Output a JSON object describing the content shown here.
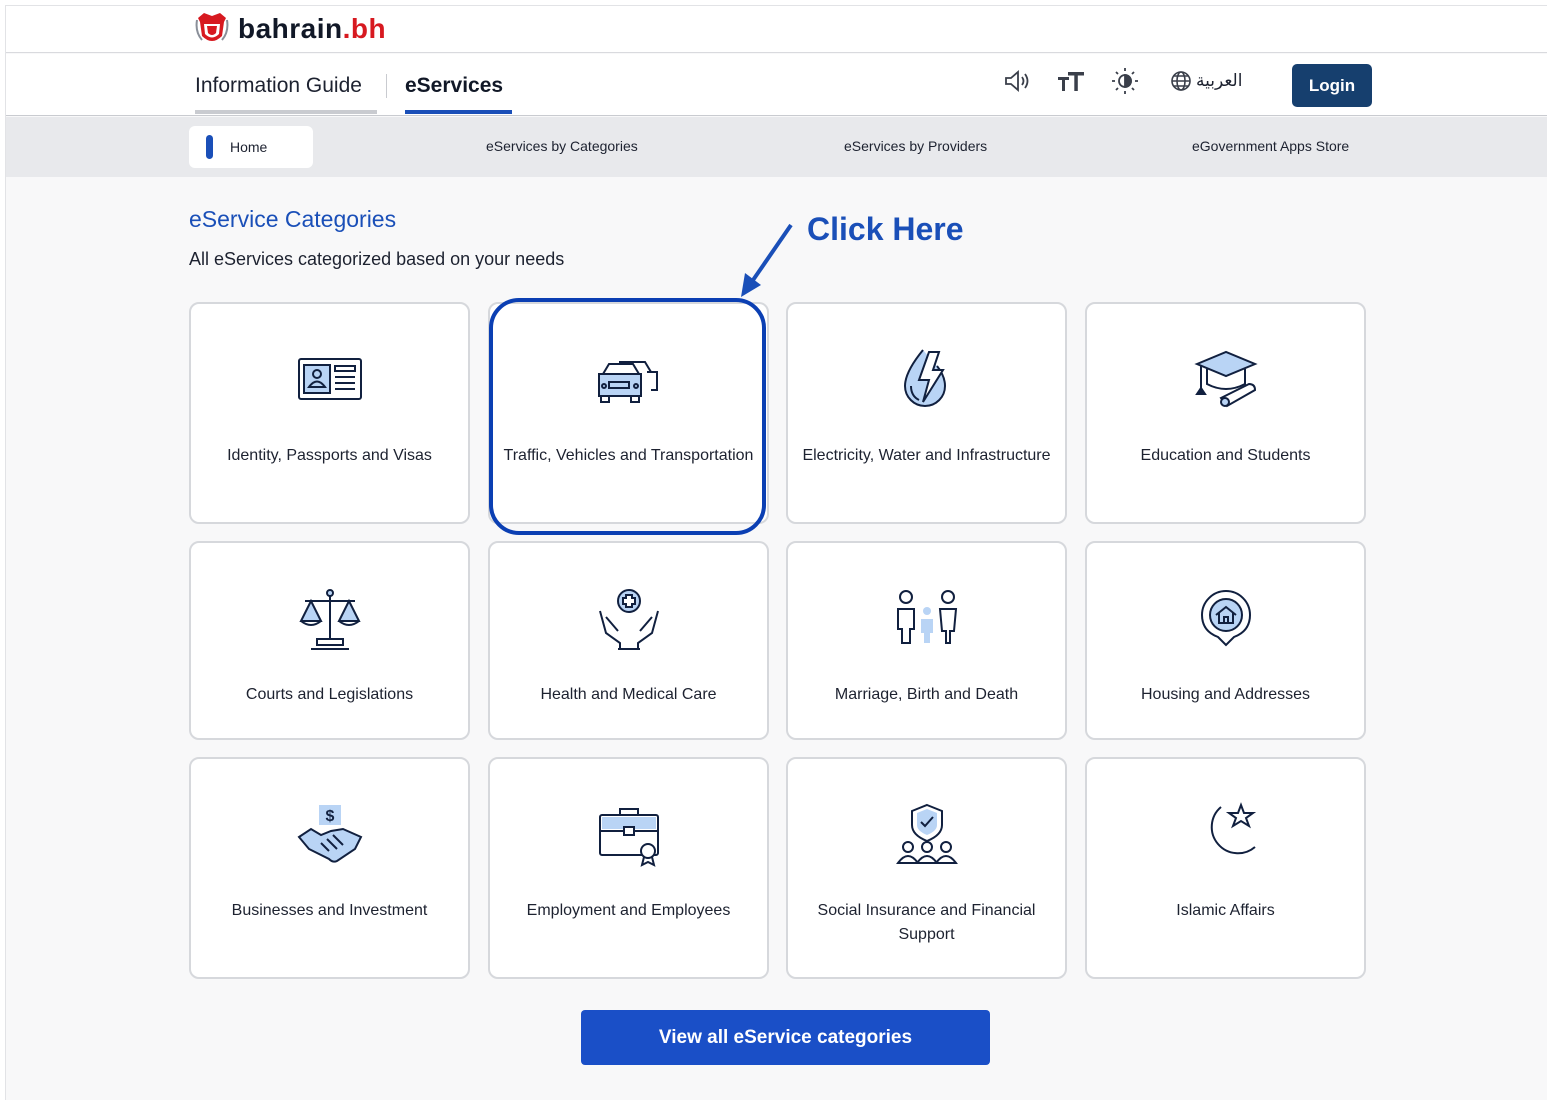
{
  "brand": {
    "name": "bahrain",
    "tld": ".bh"
  },
  "main_tabs": [
    {
      "label": "Information Guide",
      "active": false
    },
    {
      "label": "eServices",
      "active": true
    }
  ],
  "toolbar": {
    "icons": [
      "speaker-icon",
      "text-size-icon",
      "contrast-icon",
      "globe-icon"
    ],
    "language_label": "العربية",
    "login_label": "Login"
  },
  "sub_nav": [
    {
      "label": "Home",
      "active": true
    },
    {
      "label": "eServices by Categories"
    },
    {
      "label": "eServices by Providers"
    },
    {
      "label": "eGovernment Apps Store"
    }
  ],
  "section": {
    "title": "eService Categories",
    "subtitle": "All eServices categorized based on your needs"
  },
  "annotation": {
    "label": "Click Here",
    "target": "Traffic, Vehicles and Transportation"
  },
  "categories": [
    {
      "label": "Identity, Passports and Visas",
      "icon": "id-card-icon"
    },
    {
      "label": "Traffic, Vehicles and Transportation",
      "icon": "cars-icon"
    },
    {
      "label": "Electricity, Water and Infrastructure",
      "icon": "water-electricity-icon"
    },
    {
      "label": "Education and Students",
      "icon": "graduation-cap-icon"
    },
    {
      "label": "Courts and Legislations",
      "icon": "scales-icon"
    },
    {
      "label": "Health and Medical Care",
      "icon": "health-hands-icon"
    },
    {
      "label": "Marriage, Birth and Death",
      "icon": "family-icon"
    },
    {
      "label": "Housing and Addresses",
      "icon": "house-pin-icon"
    },
    {
      "label": "Businesses and Investment",
      "icon": "handshake-icon"
    },
    {
      "label": "Employment and Employees",
      "icon": "briefcase-icon"
    },
    {
      "label": "Social Insurance and Financial Support",
      "icon": "shield-people-icon"
    },
    {
      "label": "Islamic Affairs",
      "icon": "crescent-star-icon"
    }
  ],
  "view_all_label": "View all eService categories",
  "colors": {
    "accent": "#1a4fb8",
    "login_bg": "#163f6e",
    "brand_red": "#d71920"
  }
}
